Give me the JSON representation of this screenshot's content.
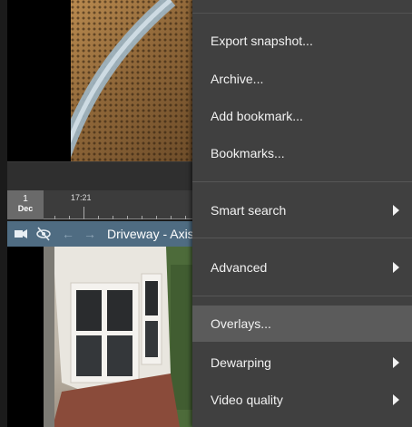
{
  "timeline": {
    "day": "1",
    "month": "Dec",
    "time": "17:21"
  },
  "camera_toolbar": {
    "title": "Driveway - Axis",
    "icons": [
      "camera-icon",
      "eye-off-icon",
      "back-arrow-icon",
      "forward-arrow-icon"
    ]
  },
  "menu": {
    "items": [
      {
        "label": "Export snapshot...",
        "submenu": false
      },
      {
        "label": "Archive...",
        "submenu": false
      },
      {
        "label": "Add bookmark...",
        "submenu": false
      },
      {
        "label": "Bookmarks...",
        "submenu": false
      },
      {
        "label": "Smart search",
        "submenu": true
      },
      {
        "label": "Advanced",
        "submenu": true
      },
      {
        "label": "Overlays...",
        "submenu": false,
        "highlighted": true
      },
      {
        "label": "Dewarping",
        "submenu": true
      },
      {
        "label": "Video quality",
        "submenu": true
      }
    ]
  },
  "colors": {
    "menu_bg": "#404040",
    "menu_highlight": "#5b5b5b",
    "camera_toolbar": "#4f6c82"
  }
}
